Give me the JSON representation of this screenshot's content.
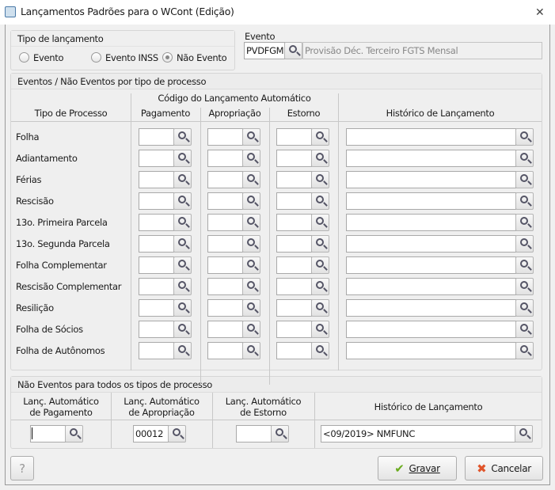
{
  "window": {
    "title": "Lançamentos Padrões para o WCont (Edição)",
    "close_icon": "close-icon"
  },
  "tipo_lancamento": {
    "title": "Tipo de lançamento",
    "options": [
      {
        "label": "Evento",
        "selected": false
      },
      {
        "label": "Evento INSS",
        "selected": false
      },
      {
        "label": "Não Evento",
        "selected": true
      }
    ]
  },
  "evento": {
    "label": "Evento",
    "code": "PVDFGM",
    "description": "Provisão Déc. Terceiro FGTS Mensal"
  },
  "processos": {
    "title": "Eventos / Não Eventos por tipo de processo",
    "col_tipo": "Tipo de Processo",
    "col_codigo": "Código do Lançamento Automático",
    "col_pagamento": "Pagamento",
    "col_apropriacao": "Apropriação",
    "col_estorno": "Estorno",
    "col_historico": "Histórico de Lançamento",
    "rows": [
      {
        "label": "Folha",
        "pagamento": "",
        "apropriacao": "",
        "estorno": "",
        "historico": ""
      },
      {
        "label": "Adiantamento",
        "pagamento": "",
        "apropriacao": "",
        "estorno": "",
        "historico": ""
      },
      {
        "label": "Férias",
        "pagamento": "",
        "apropriacao": "",
        "estorno": "",
        "historico": ""
      },
      {
        "label": "Rescisão",
        "pagamento": "",
        "apropriacao": "",
        "estorno": "",
        "historico": ""
      },
      {
        "label": "13o. Primeira Parcela",
        "pagamento": "",
        "apropriacao": "",
        "estorno": "",
        "historico": ""
      },
      {
        "label": "13o. Segunda Parcela",
        "pagamento": "",
        "apropriacao": "",
        "estorno": "",
        "historico": ""
      },
      {
        "label": "Folha Complementar",
        "pagamento": "",
        "apropriacao": "",
        "estorno": "",
        "historico": ""
      },
      {
        "label": "Rescisão Complementar",
        "pagamento": "",
        "apropriacao": "",
        "estorno": "",
        "historico": ""
      },
      {
        "label": "Resilição",
        "pagamento": "",
        "apropriacao": "",
        "estorno": "",
        "historico": ""
      },
      {
        "label": "Folha de Sócios",
        "pagamento": "",
        "apropriacao": "",
        "estorno": "",
        "historico": ""
      },
      {
        "label": "Folha de Autônomos",
        "pagamento": "",
        "apropriacao": "",
        "estorno": "",
        "historico": ""
      }
    ]
  },
  "nao_eventos": {
    "title": "Não Eventos para todos os tipos de processo",
    "col_pagamento": "Lanç. Automático\nde Pagamento",
    "col_apropriacao": "Lanç. Automático\nde Apropriação",
    "col_estorno": "Lanç. Automático\nde Estorno",
    "col_historico": "Histórico de Lançamento",
    "pagamento": "",
    "apropriacao": "00012",
    "estorno": "",
    "historico": "<09/2019> NMFUNC"
  },
  "buttons": {
    "help": "?",
    "save": "Gravar",
    "cancel": "Cancelar"
  }
}
